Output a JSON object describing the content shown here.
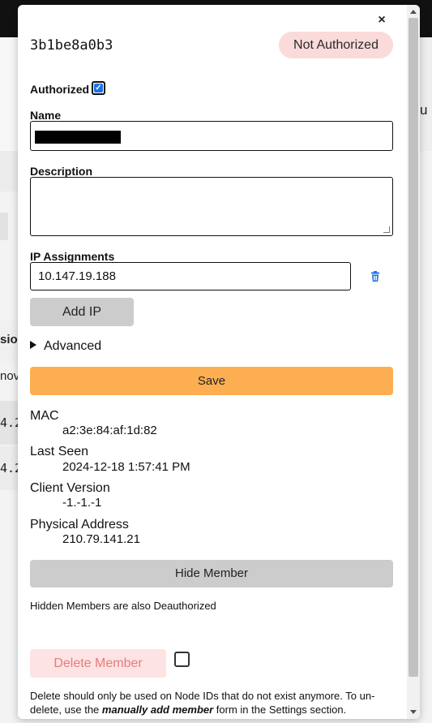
{
  "background": {
    "right_fragment": "u",
    "left_fragments": [
      "sio",
      "nov",
      "4.2",
      "4.2"
    ]
  },
  "modal": {
    "close_label": "×",
    "node_id": "3b1be8a0b3",
    "status_badge": "Not Authorized",
    "authorized": {
      "label": "Authorized",
      "checked": true
    },
    "name": {
      "label": "Name",
      "value": ""
    },
    "description": {
      "label": "Description",
      "value": ""
    },
    "ip_assignments": {
      "label": "IP Assignments",
      "items": [
        "10.147.19.188"
      ],
      "add_label": "Add IP"
    },
    "advanced_label": "Advanced",
    "save_label": "Save",
    "details": [
      {
        "label": "MAC",
        "value": "a2:3e:84:af:1d:82"
      },
      {
        "label": "Last Seen",
        "value": "2024-12-18 1:57:41 PM"
      },
      {
        "label": "Client Version",
        "value": "-1.-1.-1"
      },
      {
        "label": "Physical Address",
        "value": "210.79.141.21"
      }
    ],
    "hide_member_label": "Hide Member",
    "hidden_note": "Hidden Members are also Deauthorized",
    "delete_member_label": "Delete Member",
    "delete_note": {
      "before": "Delete should only be used on Node IDs that do not exist anymore. To un-delete, use the ",
      "emphasis": "manually add member",
      "after": " form in the Settings section."
    }
  },
  "colors": {
    "status_badge_bg": "#fadada",
    "save_button": "#feae52",
    "delete_button_bg": "#fde3e3",
    "delete_button_text": "#e77b7b",
    "trash_icon": "#1a73e8"
  }
}
